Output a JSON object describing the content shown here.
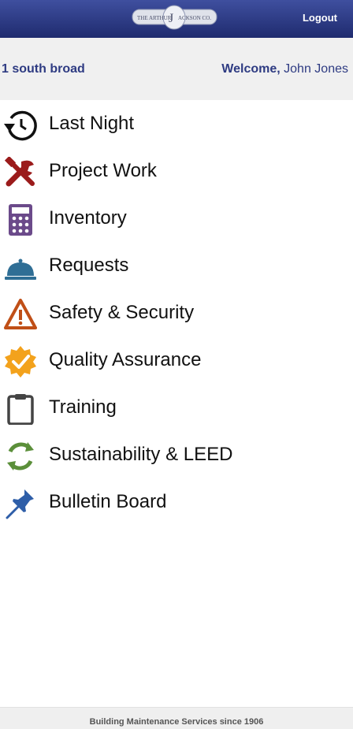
{
  "header": {
    "logo_text": "THE ARTHUR JACKSON CO.",
    "logout_label": "Logout",
    "colors": {
      "bar_top": "#3f4f9f",
      "bar_bottom": "#1f2b6f"
    }
  },
  "user_bar": {
    "location": "1 south broad",
    "welcome_label": "Welcome,",
    "user_name": "John Jones"
  },
  "menu": {
    "items": [
      {
        "label": "Last Night",
        "icon": "history-clock-icon",
        "color": "#111111"
      },
      {
        "label": "Project Work",
        "icon": "tools-icon",
        "color": "#9b1b1b"
      },
      {
        "label": "Inventory",
        "icon": "calculator-icon",
        "color": "#6b4a8a"
      },
      {
        "label": "Requests",
        "icon": "service-bell-icon",
        "color": "#2f6e95"
      },
      {
        "label": "Safety & Security",
        "icon": "warning-triangle-icon",
        "color": "#c04f17"
      },
      {
        "label": "Quality Assurance",
        "icon": "check-badge-icon",
        "color": "#f3a21c"
      },
      {
        "label": "Training",
        "icon": "clipboard-icon",
        "color": "#444444"
      },
      {
        "label": "Sustainability & LEED",
        "icon": "recycle-icon",
        "color": "#5b8f3a"
      },
      {
        "label": "Bulletin Board",
        "icon": "pushpin-icon",
        "color": "#2e5ea8"
      }
    ]
  },
  "footer": {
    "tagline": "Building Maintenance Services since 1906"
  }
}
